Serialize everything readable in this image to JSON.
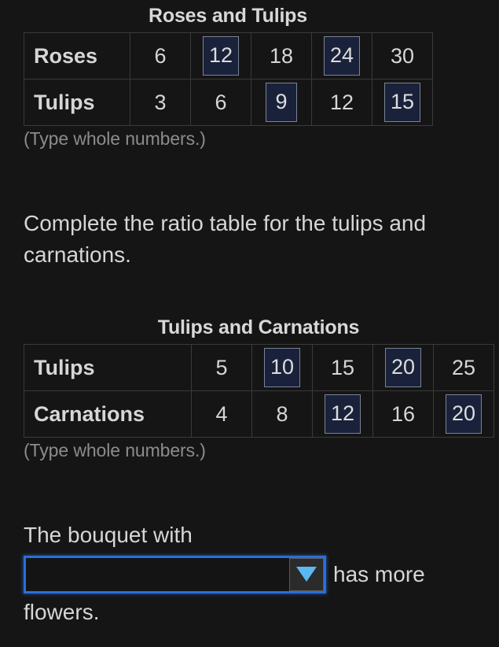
{
  "background_color": "#151515",
  "text_color": "#d6d6d6",
  "hint_color": "#8c8c8c",
  "answer_cell_fill": "#19223a",
  "answer_cell_border": "#7a8494",
  "focus_border_color": "#2a6fd8",
  "dropdown_arrow_color": "#5cb8f0",
  "table_border_color": "#3a3a3a",
  "tables": [
    {
      "id": "roses-tulips",
      "title": "Roses and Tulips",
      "hint": "(Type whole numbers.)",
      "rows": [
        {
          "label": "Roses",
          "cells": [
            {
              "value": "6",
              "input": false
            },
            {
              "value": "12",
              "input": true
            },
            {
              "value": "18",
              "input": false
            },
            {
              "value": "24",
              "input": true
            },
            {
              "value": "30",
              "input": false
            }
          ]
        },
        {
          "label": "Tulips",
          "cells": [
            {
              "value": "3",
              "input": false
            },
            {
              "value": "6",
              "input": false
            },
            {
              "value": "9",
              "input": true
            },
            {
              "value": "12",
              "input": false
            },
            {
              "value": "15",
              "input": true
            }
          ]
        }
      ]
    },
    {
      "id": "tulips-carnations",
      "title": "Tulips and Carnations",
      "hint": "(Type whole numbers.)",
      "rows": [
        {
          "label": "Tulips",
          "cells": [
            {
              "value": "5",
              "input": false
            },
            {
              "value": "10",
              "input": true
            },
            {
              "value": "15",
              "input": false
            },
            {
              "value": "20",
              "input": true
            },
            {
              "value": "25",
              "input": false
            }
          ]
        },
        {
          "label": "Carnations",
          "cells": [
            {
              "value": "4",
              "input": false
            },
            {
              "value": "8",
              "input": false
            },
            {
              "value": "12",
              "input": true
            },
            {
              "value": "16",
              "input": false
            },
            {
              "value": "20",
              "input": true
            }
          ]
        }
      ]
    }
  ],
  "prompts": {
    "complete_ratio_table": "Complete the ratio table for the tulips and carnations."
  },
  "answer_sentence": {
    "lead_text": "The bouquet with",
    "dropdown": {
      "value": "",
      "arrow_icon": "chevron-down-icon"
    },
    "after_text": "has more",
    "trailing_text": "flowers."
  }
}
